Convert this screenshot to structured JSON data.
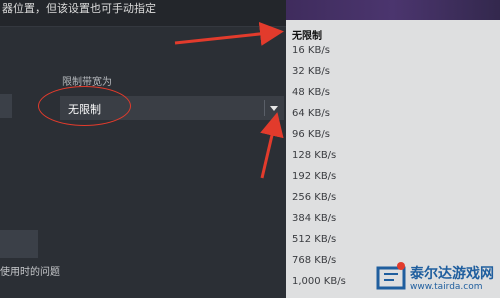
{
  "settings": {
    "top_hint": "器位置，但该设置也可手动指定",
    "bandwidth_label": "限制带宽为",
    "bandwidth_value": "无限制",
    "bottom_hint": "使用时的问题"
  },
  "dropdown": {
    "options": [
      "无限制",
      "16 KB/s",
      "32 KB/s",
      "48 KB/s",
      "64 KB/s",
      "96 KB/s",
      "128 KB/s",
      "192 KB/s",
      "256 KB/s",
      "384 KB/s",
      "512 KB/s",
      "768 KB/s",
      "1,000 KB/s"
    ],
    "selected_option": "无限制"
  },
  "watermark": {
    "site_name": "泰尔达游戏网",
    "site_url": "www.tairda.com"
  },
  "colors": {
    "annotation_red": "#e23b2c",
    "panel_bg": "#2b2f35",
    "dropdown_bg": "#dedfe0"
  }
}
